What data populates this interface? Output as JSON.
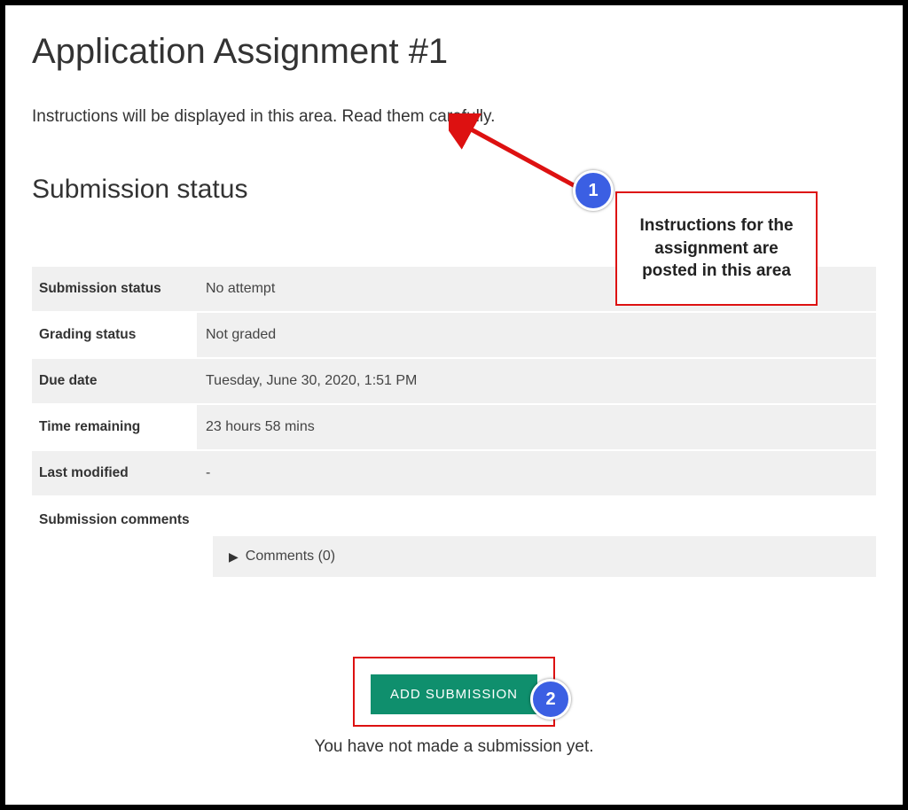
{
  "page": {
    "title": "Application Assignment #1",
    "instructions_text": "Instructions will be displayed in this area. Read them carefully.",
    "section_title": "Submission status"
  },
  "status": {
    "submission_status": {
      "label": "Submission status",
      "value": "No attempt"
    },
    "grading_status": {
      "label": "Grading status",
      "value": "Not graded"
    },
    "due_date": {
      "label": "Due date",
      "value": "Tuesday, June 30, 2020, 1:51 PM"
    },
    "time_remaining": {
      "label": "Time remaining",
      "value": "23 hours 58 mins"
    },
    "last_modified": {
      "label": "Last modified",
      "value": "-"
    },
    "submission_comments": {
      "label": "Submission comments",
      "value": "Comments (0)"
    }
  },
  "actions": {
    "add_submission_label": "ADD SUBMISSION",
    "no_submission_text": "You have not made a submission yet."
  },
  "annotations": {
    "callout1_text": "Instructions for the assignment are posted in this area",
    "badge1": "1",
    "badge2": "2"
  }
}
